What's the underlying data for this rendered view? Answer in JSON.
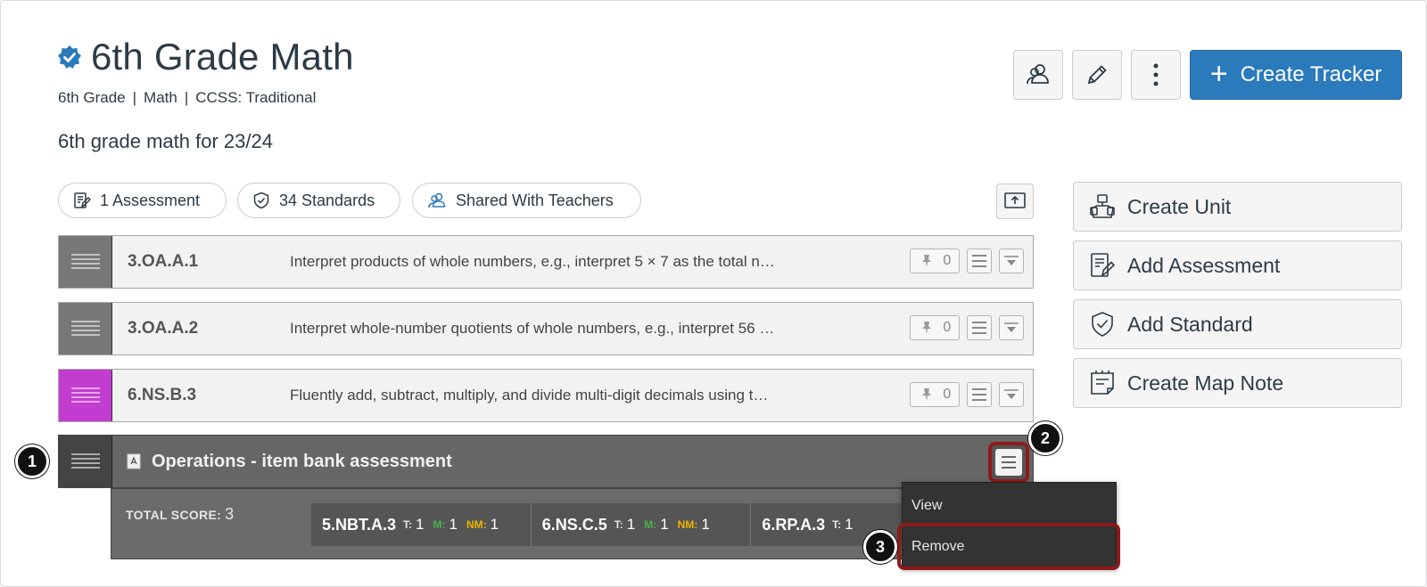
{
  "course": {
    "title": "6th Grade Math",
    "meta": [
      "6th Grade",
      "Math",
      "CCSS: Traditional"
    ],
    "meta_separator": "|",
    "description": "6th grade math for 23/24"
  },
  "header_actions": {
    "create_tracker_label": "Create Tracker"
  },
  "pills": [
    {
      "label": "1 Assessment",
      "icon": "assessment-icon"
    },
    {
      "label": "34 Standards",
      "icon": "shield-check-icon"
    },
    {
      "label": "Shared With Teachers",
      "icon": "users-icon"
    }
  ],
  "side_actions": [
    {
      "label": "Create Unit",
      "icon": "unit-icon"
    },
    {
      "label": "Add Assessment",
      "icon": "assessment-icon"
    },
    {
      "label": "Add Standard",
      "icon": "shield-check-icon"
    },
    {
      "label": "Create Map Note",
      "icon": "note-icon"
    }
  ],
  "standards": [
    {
      "code": "3.OA.A.1",
      "description": "Interpret products of whole numbers, e.g., interpret 5 × 7 as the total n…",
      "pins": "0",
      "color": "#777777"
    },
    {
      "code": "3.OA.A.2",
      "description": "Interpret whole-number quotients of whole numbers, e.g., interpret 56 …",
      "pins": "0",
      "color": "#777777"
    },
    {
      "code": "6.NS.B.3",
      "description": "Fluently add, subtract, multiply, and divide multi-digit decimals using t…",
      "pins": "0",
      "color": "#c23ccf"
    }
  ],
  "assessment": {
    "title": "Operations - item bank assessment",
    "total_score_label": "TOTAL SCORE:",
    "total_score": "3",
    "scores": [
      {
        "code": "5.NBT.A.3",
        "t_label": "T:",
        "t": "1",
        "m_label": "M:",
        "m": "1",
        "nm_label": "NM:",
        "nm": "1"
      },
      {
        "code": "6.NS.C.5",
        "t_label": "T:",
        "t": "1",
        "m_label": "M:",
        "m": "1",
        "nm_label": "NM:",
        "nm": "1"
      },
      {
        "code": "6.RP.A.3",
        "t_label": "T:",
        "t": "1",
        "m_label": "",
        "m": "",
        "nm_label": "",
        "nm": ""
      }
    ]
  },
  "menu": {
    "view_label": "View",
    "remove_label": "Remove"
  },
  "callouts": [
    "1",
    "2",
    "3"
  ],
  "colors": {
    "primary": "#2b7abc",
    "highlight": "#8e1b1b",
    "mastered": "#4caf50",
    "near_mastery": "#f0b400"
  }
}
